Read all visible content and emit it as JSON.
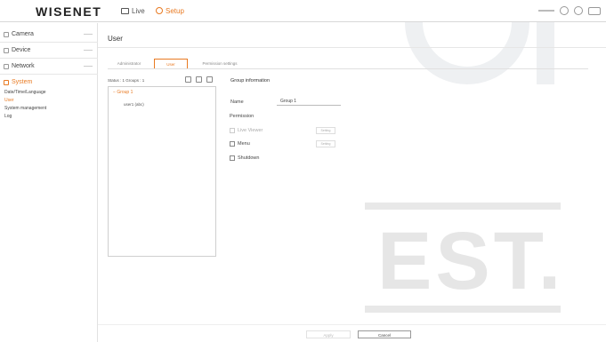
{
  "topbar": {
    "logo": "WISENET",
    "live_label": "Live",
    "setup_label": "Setup"
  },
  "sidebar": {
    "items": [
      {
        "label": "Camera"
      },
      {
        "label": "Device"
      },
      {
        "label": "Network"
      },
      {
        "label": "System"
      }
    ],
    "submenu": [
      {
        "label": "Date/Time/Language"
      },
      {
        "label": "User"
      },
      {
        "label": "System management"
      },
      {
        "label": "Log"
      }
    ]
  },
  "main": {
    "title": "User",
    "tabs": [
      {
        "label": "Administrator"
      },
      {
        "label": "User"
      },
      {
        "label": "Permission settings"
      }
    ],
    "status_text": "Status : 1 Groups : 1",
    "tree": {
      "group": "Group 1",
      "user": "user1 (abc)"
    },
    "group_info": {
      "title": "Group information",
      "name_label": "Name",
      "name_value": "Group 1",
      "permission_label": "Permission",
      "permissions": [
        {
          "label": "Live Viewer",
          "button": "Setting",
          "enabled": false
        },
        {
          "label": "Menu",
          "button": "Setting",
          "enabled": true
        },
        {
          "label": "Shutdown",
          "enabled": true
        }
      ]
    }
  },
  "footer": {
    "apply_label": "Apply",
    "cancel_label": "Cancel"
  },
  "colors": {
    "accent": "#e87a22"
  }
}
